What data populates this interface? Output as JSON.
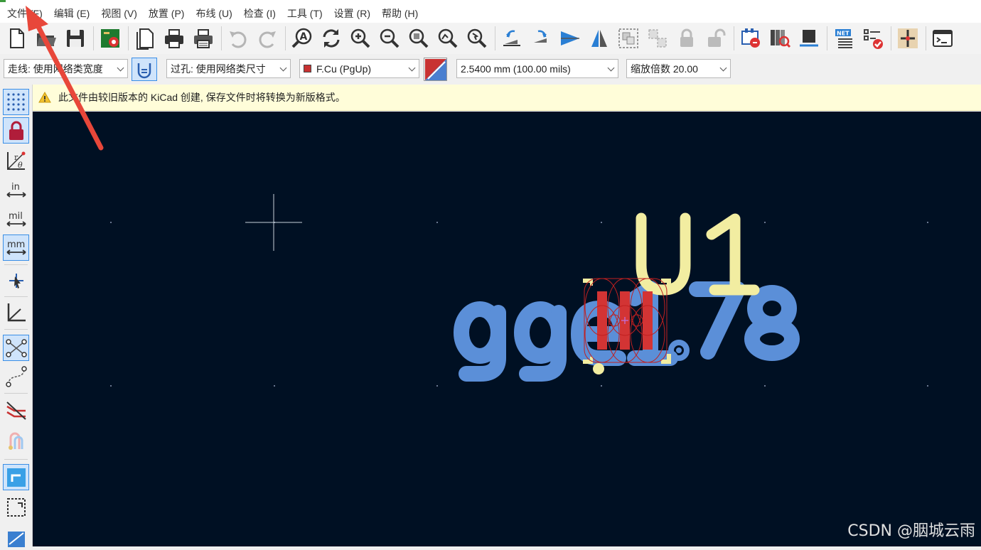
{
  "menu": {
    "items": [
      {
        "label": "文件 (F)"
      },
      {
        "label": "编辑 (E)"
      },
      {
        "label": "视图 (V)"
      },
      {
        "label": "放置 (P)"
      },
      {
        "label": "布线 (U)"
      },
      {
        "label": "检查 (I)"
      },
      {
        "label": "工具 (T)"
      },
      {
        "label": "设置 (R)"
      },
      {
        "label": "帮助 (H)"
      }
    ]
  },
  "toolbar": {
    "icons": [
      "new-board-icon",
      "open-icon",
      "save-icon",
      "board-setup-icon",
      "page-settings-icon",
      "print-icon",
      "plot-icon",
      "undo-icon",
      "redo-icon",
      "find-icon",
      "refresh-icon",
      "zoom-in-icon",
      "zoom-out-icon",
      "zoom-fit-icon",
      "zoom-objects-icon",
      "zoom-selection-icon",
      "rotate-ccw-icon",
      "rotate-cw-icon",
      "flip-icon",
      "mirror-icon",
      "group-icon",
      "ungroup-icon",
      "lock-icon",
      "unlock-icon",
      "update-from-schematic-icon",
      "footprint-library-icon",
      "footprint-editor-icon",
      "netlist-icon",
      "drc-icon",
      "scripting-icon",
      "console-icon"
    ]
  },
  "options": {
    "track_width": "走线: 使用网络类宽度",
    "via_size": "过孔: 使用网络类尺寸",
    "layer": "F.Cu (PgUp)",
    "grid": "2.5400 mm (100.00 mils)",
    "zoom": "缩放倍数 20.00",
    "layer_color": "#c83232"
  },
  "infobar": {
    "message": "此文件由较旧版本的 KiCad 创建, 保存文件时将转换为新版格式。"
  },
  "left_toolbar": {
    "units": {
      "in": "in",
      "mil": "mil",
      "mm": "mm"
    },
    "polar": "r θ"
  },
  "canvas": {
    "background": "#001023",
    "reference": "U1",
    "value": "gge1.78",
    "silk_color": "#f2eda1",
    "fab_color": "#5b8fd8",
    "pad_color": "#d33434"
  },
  "watermark": "CSDN @胭城云雨"
}
